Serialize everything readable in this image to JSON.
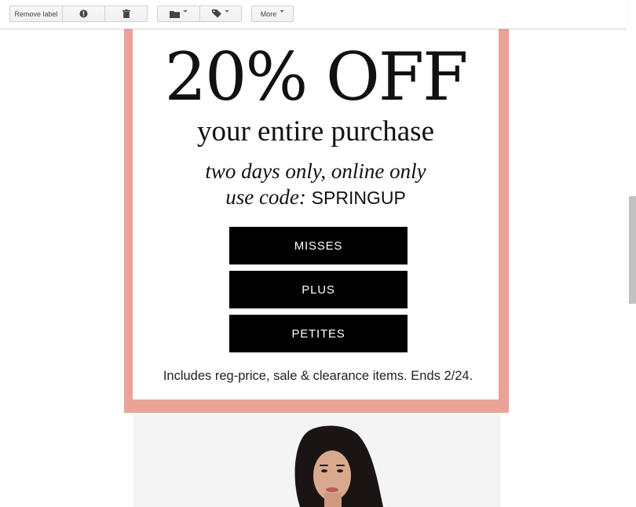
{
  "toolbar": {
    "remove_label": "Remove label",
    "report_icon": "report-spam-icon",
    "delete_icon": "trash-icon",
    "move_icon": "folder-icon",
    "labels_icon": "label-tag-icon",
    "more_label": "More"
  },
  "promo": {
    "headline": "20% OFF",
    "subhead": "your entire purchase",
    "line1": "two days only, online only",
    "code_prefix": "use code:",
    "code": "SPRINGUP",
    "buttons": [
      "MISSES",
      "PLUS",
      "PETITES"
    ],
    "fineprint": "Includes reg-price, sale & clearance items. Ends 2/24."
  },
  "colors": {
    "frame": "#eba398",
    "button_bg": "#000000",
    "button_text": "#ffffff"
  }
}
